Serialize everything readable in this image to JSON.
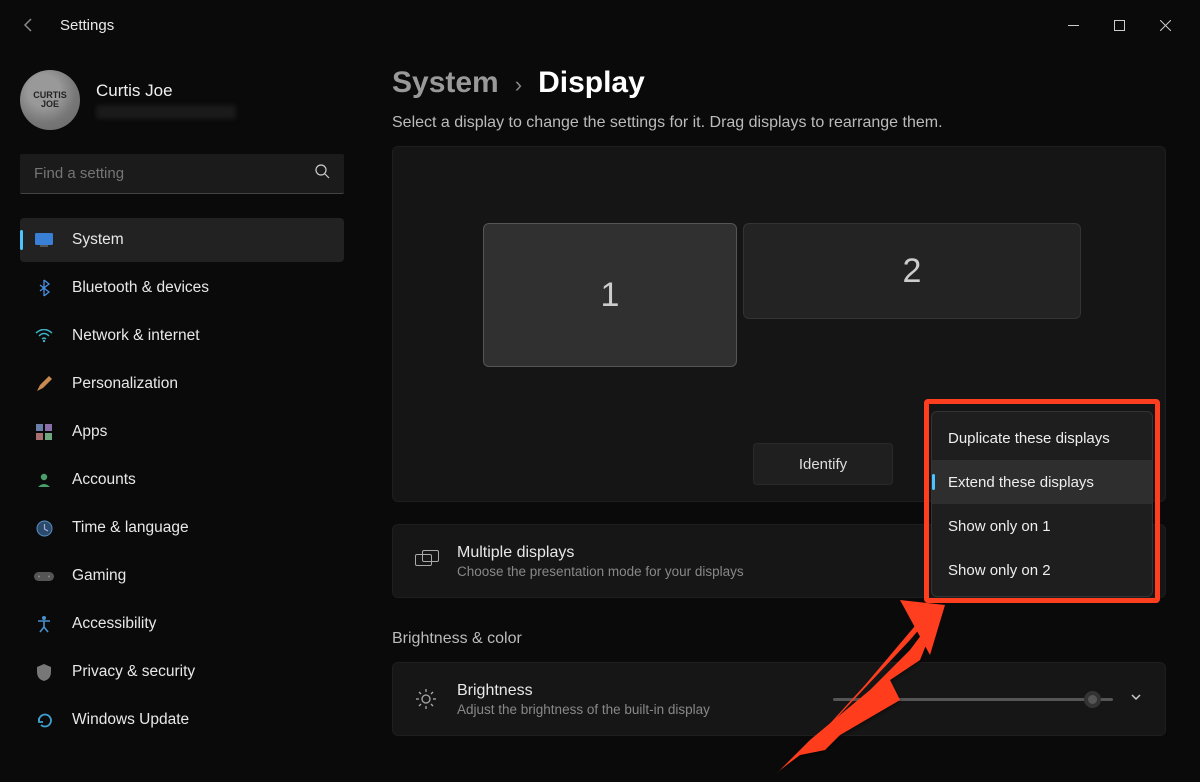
{
  "app_title": "Settings",
  "user": {
    "name": "Curtis Joe"
  },
  "search": {
    "placeholder": "Find a setting"
  },
  "sidebar": {
    "items": [
      {
        "label": "System"
      },
      {
        "label": "Bluetooth & devices"
      },
      {
        "label": "Network & internet"
      },
      {
        "label": "Personalization"
      },
      {
        "label": "Apps"
      },
      {
        "label": "Accounts"
      },
      {
        "label": "Time & language"
      },
      {
        "label": "Gaming"
      },
      {
        "label": "Accessibility"
      },
      {
        "label": "Privacy & security"
      },
      {
        "label": "Windows Update"
      }
    ]
  },
  "breadcrumb": {
    "parent": "System",
    "sep": "›",
    "current": "Display"
  },
  "description": "Select a display to change the settings for it. Drag displays to rearrange them.",
  "monitors": {
    "m1": "1",
    "m2": "2"
  },
  "identify_label": "Identify",
  "dropdown": {
    "items": [
      {
        "label": "Duplicate these displays"
      },
      {
        "label": "Extend these displays"
      },
      {
        "label": "Show only on 1"
      },
      {
        "label": "Show only on 2"
      }
    ]
  },
  "multi_displays": {
    "title": "Multiple displays",
    "desc": "Choose the presentation mode for your displays"
  },
  "section_brightness": "Brightness & color",
  "brightness": {
    "title": "Brightness",
    "desc": "Adjust the brightness of the built-in display"
  }
}
